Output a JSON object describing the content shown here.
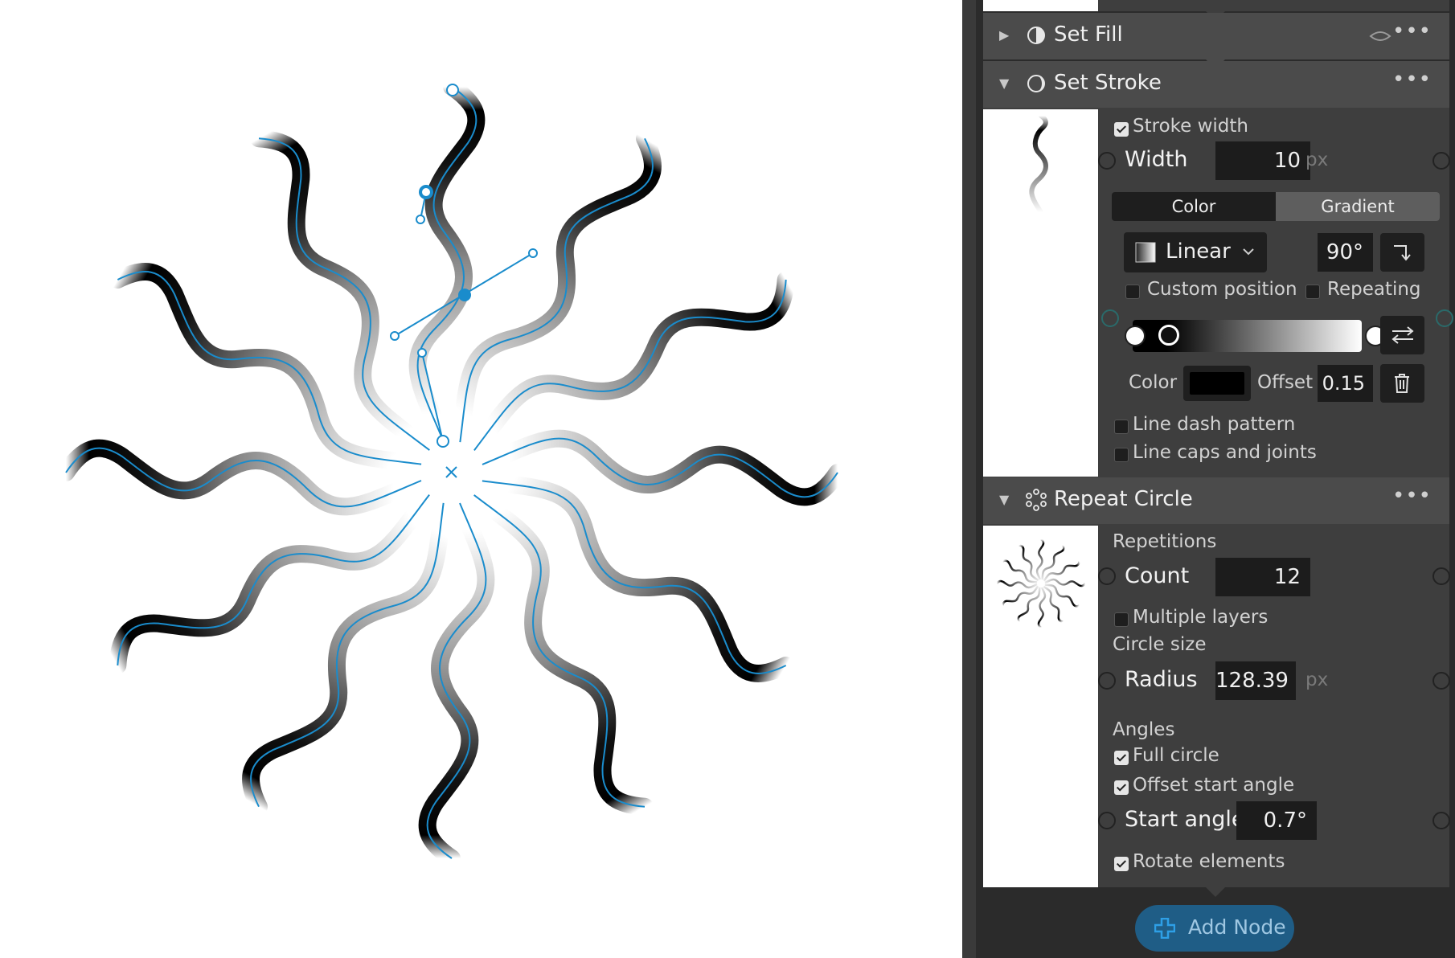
{
  "nodes": {
    "set_fill": {
      "title": "Set Fill"
    },
    "set_stroke": {
      "title": "Set Stroke",
      "stroke_width_label": "Stroke width",
      "width_label": "Width",
      "width_value": "10",
      "width_unit": "px",
      "tab_color": "Color",
      "tab_gradient": "Gradient",
      "gradient_type": "Linear",
      "gradient_angle": "90°",
      "custom_position_label": "Custom position",
      "repeating_label": "Repeating",
      "stop_color_label": "Color",
      "stop_color_value": "#000000",
      "offset_label": "Offset",
      "offset_value": "0.15",
      "line_dash_label": "Line dash pattern",
      "line_caps_label": "Line caps and joints"
    },
    "repeat_circle": {
      "title": "Repeat Circle",
      "repetitions_label": "Repetitions",
      "count_label": "Count",
      "count_value": "12",
      "multiple_layers_label": "Multiple layers",
      "circle_size_label": "Circle size",
      "radius_label": "Radius",
      "radius_value": "128.39",
      "radius_unit": "px",
      "angles_label": "Angles",
      "full_circle_label": "Full circle",
      "offset_start_angle_label": "Offset start angle",
      "start_angle_label": "Start angle",
      "start_angle_value": "0.7°",
      "rotate_elements_label": "Rotate elements"
    }
  },
  "add_node_label": "Add Node",
  "colors": {
    "accent": "#1a8ccc",
    "panel_bg": "#2b2b2b",
    "card_bg": "#3e3e3e",
    "header_bg": "#4b4b4b",
    "button_blue": "#1f5d86"
  },
  "icons": {
    "expand": "triangle-right-icon",
    "collapse": "triangle-down-icon",
    "fill": "half-circle-icon",
    "stroke": "ring-icon",
    "repeat": "circle-of-dots-icon",
    "more": "ellipsis-icon",
    "visibility": "eye-icon",
    "swap": "swap-arrows-icon",
    "delete": "trash-icon",
    "rotate": "rotate-arrow-icon",
    "add": "plus-icon"
  }
}
